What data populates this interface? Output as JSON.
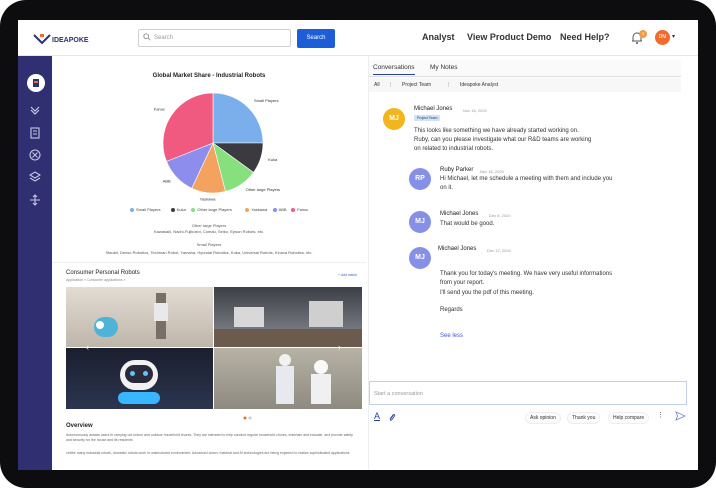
{
  "header": {
    "logo_text": "IDEAPOKE",
    "search_placeholder": "Search",
    "search_button": "Search",
    "nav": [
      "Analyst",
      "View Product Demo",
      "Need Help?"
    ],
    "notification_count": "3",
    "user_initials": "DM"
  },
  "chart": {
    "title": "Global Market Share - Industrial Robots",
    "caption1": "Other large Players",
    "caption2": "Kawasaki, Nachi-Fujikoshi, Comau, Seiko, Epson Robots, etc.",
    "caption3": "Small Players",
    "caption4": "Staubli, Denso Robotics, Techman Robot, Yamaha, Hyundai Robotics, Kuka, Universal Robots, Kinova Robotics, etc."
  },
  "chart_data": {
    "type": "pie",
    "title": "Global Market Share - Industrial Robots",
    "legend_position": "bottom",
    "slices": [
      {
        "name": "Small Players",
        "value": 25,
        "color": "#7aafeb"
      },
      {
        "name": "Kuka",
        "value": 10,
        "color": "#3a3a40"
      },
      {
        "name": "Other large Players",
        "value": 11,
        "color": "#86e07e"
      },
      {
        "name": "Yaskawa",
        "value": 11,
        "color": "#f4a25f"
      },
      {
        "name": "ABB",
        "value": 12,
        "color": "#8c8ded"
      },
      {
        "name": "Fanuc",
        "value": 31,
        "color": "#f05a81"
      }
    ]
  },
  "card": {
    "title": "Consumer Personal Robots",
    "subtitle": "Application » Consumer applications »",
    "add_label": "+ Add watch",
    "overview_title": "Overview",
    "overview_p1": "Autonomously assists users in carrying out indoor and outdoor household chores. They are intended to help conduct regular household chores, entertain and educate, and provide safety and security for the house and its residents",
    "overview_p2": "Unlike many industrial robots, domestic robots work in unstructured environment. Advanced vision, material and AI technologies are being explored to realize sophisticated applications"
  },
  "conversations": {
    "tabs": [
      "Conversations",
      "My Notes"
    ],
    "filters": [
      "All",
      "Project Team",
      "Ideapoke Analyst"
    ],
    "messages": [
      {
        "initials": "MJ",
        "name": "Michael Jones",
        "date": "Nov 16, 2020",
        "tag": "Project Team",
        "text1": "This looks like something we have already started working on.",
        "text2": "Ruby, can you please investigate what our R&D teams are working",
        "text3": "on related to industrial robots.",
        "color": "#f2b51d"
      },
      {
        "initials": "RP",
        "name": "Ruby Parker",
        "date": "Nov 16, 2020",
        "text1": "Hi Michael, let me schedule a meeting with them and include you",
        "text2": "on it.",
        "color": "#8590e6"
      },
      {
        "initials": "MJ",
        "name": "Michael Jones",
        "date": "Dec 8, 2020",
        "text1": "That would be good.",
        "color": "#8590e6"
      },
      {
        "initials": "MJ",
        "name": "Michael Jones",
        "date": "Dec 12, 2020",
        "text1": "Thank you for today's meeting. We have very useful informations",
        "text2": "from your report.",
        "text3": "I'll send you the pdf of this meeting.",
        "text4": "Regards",
        "color": "#8590e6"
      }
    ],
    "see_less": "See less",
    "input_placeholder": "Start a conversation",
    "quick_replies": [
      "Ask opinion",
      "Thank you",
      "Help compare"
    ]
  }
}
